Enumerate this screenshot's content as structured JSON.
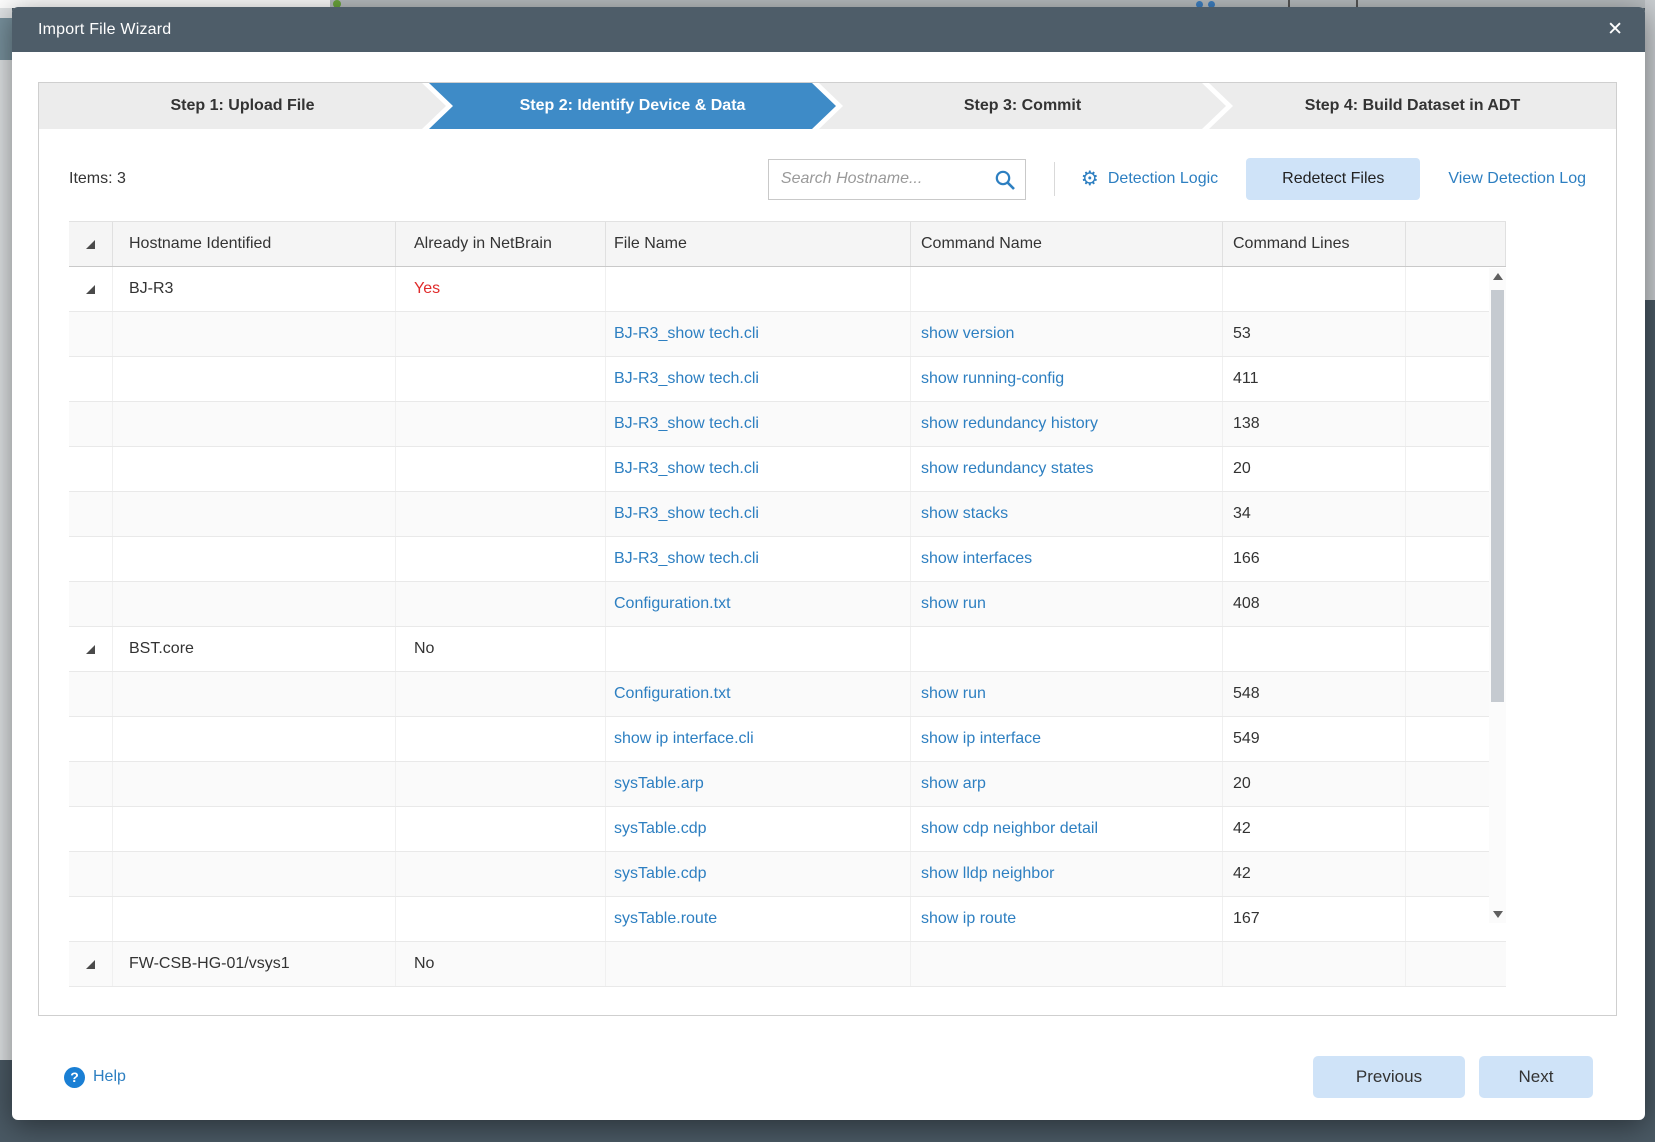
{
  "window": {
    "title": "Import File Wizard",
    "close_icon": "✕"
  },
  "wizard": {
    "steps": [
      {
        "label": "Step 1: Upload File",
        "active": false
      },
      {
        "label": "Step 2: Identify Device & Data",
        "active": true
      },
      {
        "label": "Step 3: Commit",
        "active": false
      },
      {
        "label": "Step 4: Build Dataset in ADT",
        "active": false
      }
    ]
  },
  "toolbar": {
    "items_count_label": "Items: 3",
    "search_placeholder": "Search Hostname...",
    "detection_logic_label": "Detection Logic",
    "redetect_files_label": "Redetect Files",
    "view_detection_log_label": "View Detection Log",
    "gear_icon": "⚙",
    "search_icon": "magnifier"
  },
  "table": {
    "headers": {
      "hostname": "Hostname Identified",
      "already": "Already in NetBrain",
      "file": "File Name",
      "command": "Command Name",
      "lines": "Command Lines"
    },
    "groups": [
      {
        "hostname": "BJ-R3",
        "already_in_netbrain": "Yes",
        "already_color": "red",
        "files": [
          {
            "file": "BJ-R3_show tech.cli",
            "command": "show version",
            "lines": "53"
          },
          {
            "file": "BJ-R3_show tech.cli",
            "command": "show running-config",
            "lines": "411"
          },
          {
            "file": "BJ-R3_show tech.cli",
            "command": "show redundancy history",
            "lines": "138"
          },
          {
            "file": "BJ-R3_show tech.cli",
            "command": "show redundancy states",
            "lines": "20"
          },
          {
            "file": "BJ-R3_show tech.cli",
            "command": "show stacks",
            "lines": "34"
          },
          {
            "file": "BJ-R3_show tech.cli",
            "command": "show interfaces",
            "lines": "166"
          },
          {
            "file": "Configuration.txt",
            "command": "show run",
            "lines": "408"
          }
        ]
      },
      {
        "hostname": "BST.core",
        "already_in_netbrain": "No",
        "already_color": "normal",
        "files": [
          {
            "file": "Configuration.txt",
            "command": "show run",
            "lines": "548"
          },
          {
            "file": "show ip interface.cli",
            "command": "show ip interface",
            "lines": "549"
          },
          {
            "file": "sysTable.arp",
            "command": "show arp",
            "lines": "20"
          },
          {
            "file": "sysTable.cdp",
            "command": "show cdp neighbor detail",
            "lines": "42"
          },
          {
            "file": "sysTable.cdp",
            "command": "show lldp neighbor",
            "lines": "42"
          },
          {
            "file": "sysTable.route",
            "command": "show ip route",
            "lines": "167"
          }
        ]
      },
      {
        "hostname": "FW-CSB-HG-01/vsys1",
        "already_in_netbrain": "No",
        "already_color": "normal",
        "files": []
      }
    ]
  },
  "footer": {
    "help_label": "Help",
    "help_icon": "?",
    "previous_label": "Previous",
    "next_label": "Next"
  },
  "colors": {
    "accent_blue": "#2d7fc1",
    "active_step_blue": "#3e8bc7",
    "alert_red": "#e02b2b",
    "title_bar": "#4e5d69",
    "light_blue_button": "#cfe3f8"
  }
}
